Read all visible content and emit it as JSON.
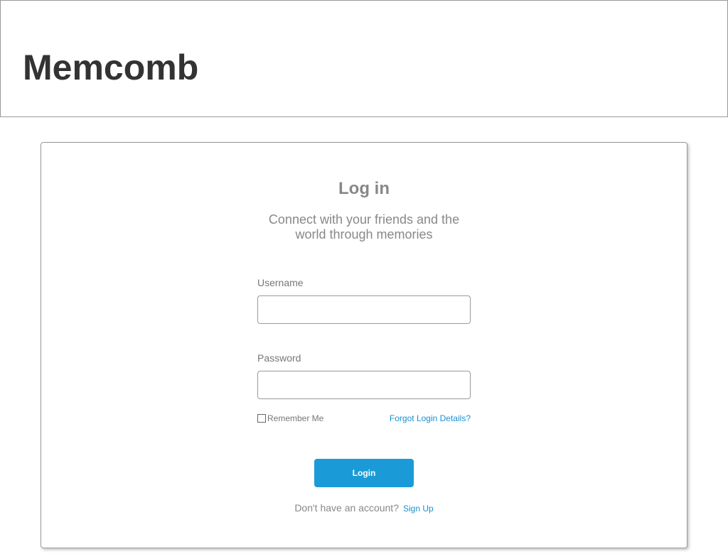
{
  "header": {
    "logo_text": "Memcomb"
  },
  "login_card": {
    "title": "Log in",
    "subtitle": "Connect with your friends and the world through memories",
    "username": {
      "label": "Username",
      "value": "",
      "placeholder": ""
    },
    "password": {
      "label": "Password",
      "value": "",
      "placeholder": ""
    },
    "remember_me": {
      "label": "Remember Me",
      "checked": false
    },
    "forgot_link": "Forgot Login Details?",
    "login_button": "Login",
    "no_account_text": "Don't have an account?",
    "signup_link": "Sign Up"
  },
  "colors": {
    "accent": "#1a9bd7",
    "link": "#1a8fd0",
    "heading_text": "#333333",
    "muted_text": "#888888"
  }
}
